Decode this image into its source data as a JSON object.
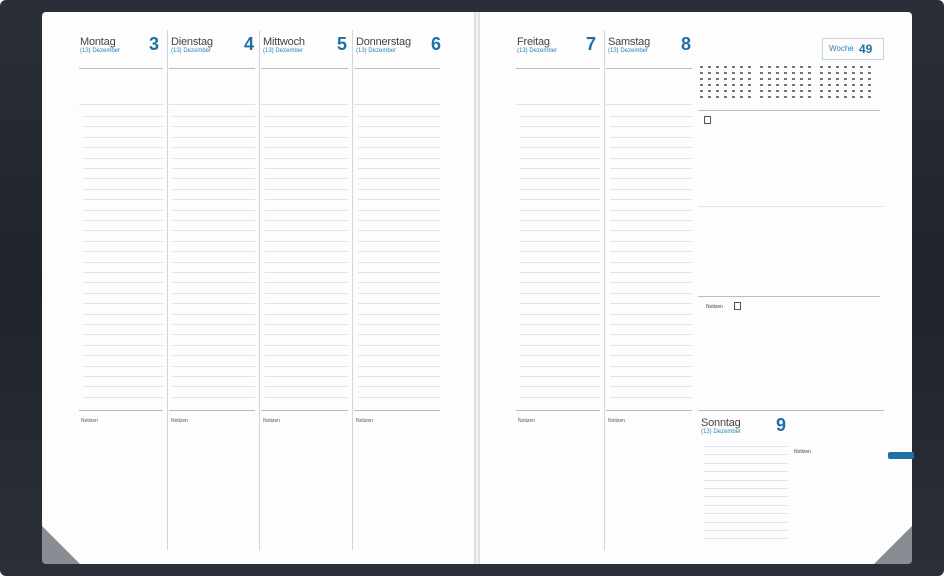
{
  "left_page": {
    "days": [
      {
        "name": "Montag",
        "number": "3",
        "sub": "(13) Dezember"
      },
      {
        "name": "Dienstag",
        "number": "4",
        "sub": "(13) Dezember"
      },
      {
        "name": "Mittwoch",
        "number": "5",
        "sub": "(13) Dezember"
      },
      {
        "name": "Donnerstag",
        "number": "6",
        "sub": "(13) Dezember"
      }
    ],
    "notes_label": "Notizen"
  },
  "right_page": {
    "days": [
      {
        "name": "Freitag",
        "number": "7",
        "sub": "(13) Dezember"
      },
      {
        "name": "Samstag",
        "number": "8",
        "sub": "(13) Dezember"
      }
    ],
    "sunday": {
      "name": "Sonntag",
      "number": "9",
      "sub": "(13) Dezember"
    },
    "week_label": "Woche",
    "week_number": "49",
    "notes_label": "Notizen",
    "todo_label": "Notizen"
  },
  "colors": {
    "accent": "#1e6fa3",
    "cover": "#1f242b"
  }
}
